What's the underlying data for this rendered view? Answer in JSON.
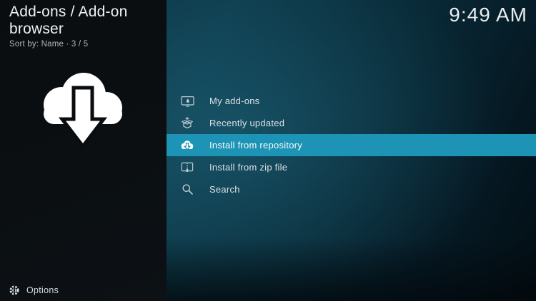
{
  "header": {
    "title": "Add-ons / Add-on browser",
    "subtitle": "Sort by: Name  ·  3 / 5"
  },
  "status": {
    "clock": "9:49 AM"
  },
  "menu": {
    "items": [
      {
        "label": "My add-ons",
        "icon": "my-addons-icon",
        "selected": false
      },
      {
        "label": "Recently updated",
        "icon": "recently-updated-icon",
        "selected": false
      },
      {
        "label": "Install from repository",
        "icon": "cloud-download-icon",
        "selected": true
      },
      {
        "label": "Install from zip file",
        "icon": "zip-file-icon",
        "selected": false
      },
      {
        "label": "Search",
        "icon": "search-icon",
        "selected": false
      }
    ]
  },
  "footer": {
    "options_label": "Options"
  },
  "artwork": {
    "icon": "cloud-download-artwork"
  },
  "colors": {
    "accent": "#1d94b5",
    "sidebar_bg": "#0b0e10",
    "content_teal": "#0d3a4a",
    "text_primary": "#eef2f3",
    "text_secondary": "#aeb7ba"
  }
}
